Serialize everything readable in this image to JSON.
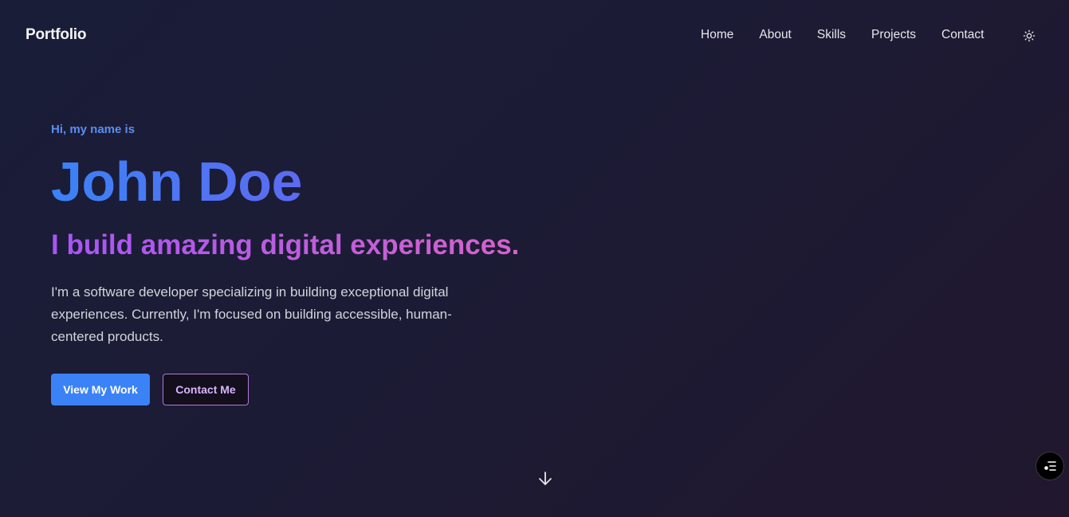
{
  "nav": {
    "brand": "Portfolio",
    "links": [
      "Home",
      "About",
      "Skills",
      "Projects",
      "Contact"
    ],
    "theme_icon": "sun-icon"
  },
  "hero": {
    "greeting": "Hi, my name is",
    "name": "John Doe",
    "tagline": "I build amazing digital experiences.",
    "description": "I'm a software developer specializing in building exceptional digital experiences. Currently, I'm focused on building accessible, human-centered products.",
    "primary_button": "View My Work",
    "secondary_button": "Contact Me"
  },
  "scroll_icon": "arrow-down-icon",
  "floating_icon": "menu-list-icon",
  "colors": {
    "background": "#1b1c36",
    "accent_blue": "#3b82f6",
    "accent_purple": "#a855f7",
    "secondary_border": "#b07ad8"
  }
}
